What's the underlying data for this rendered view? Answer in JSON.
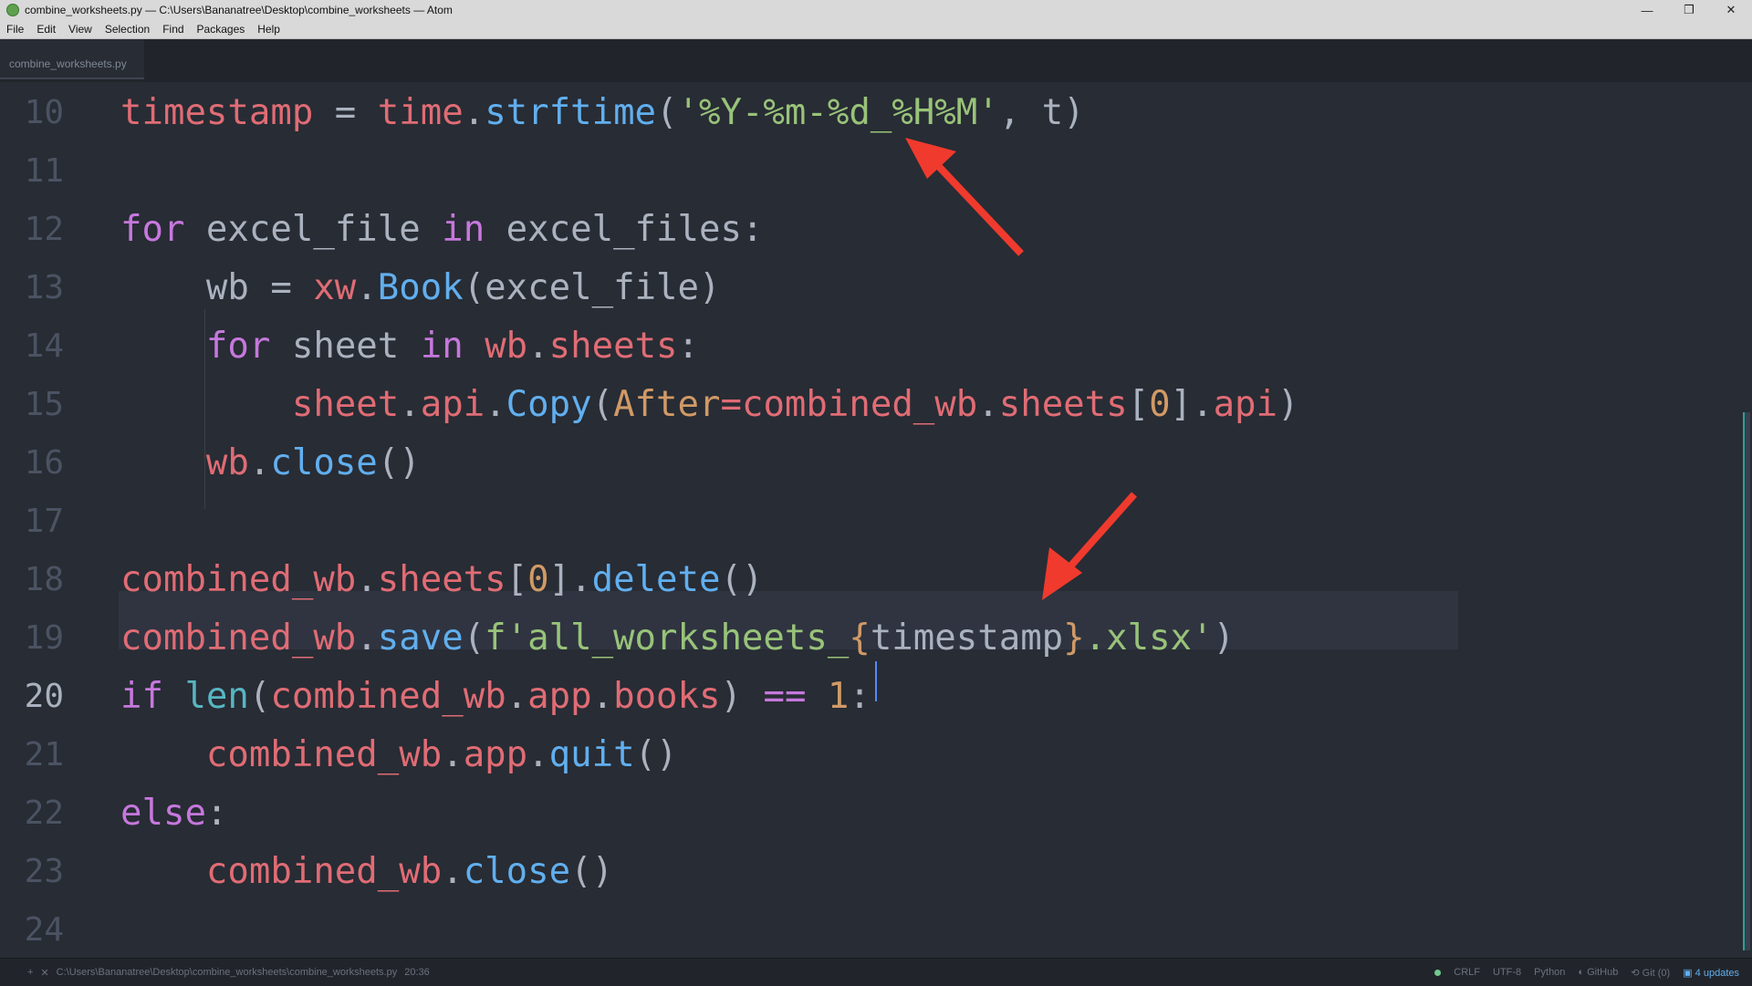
{
  "window": {
    "title": "combine_worksheets.py — C:\\Users\\Bananatree\\Desktop\\combine_worksheets — Atom",
    "minimize": "—",
    "maximize": "❐",
    "close": "✕"
  },
  "menu": [
    "File",
    "Edit",
    "View",
    "Selection",
    "Find",
    "Packages",
    "Help"
  ],
  "tab": {
    "label": "combine_worksheets.py"
  },
  "editor": {
    "active_line": "20",
    "lines": [
      {
        "num": "10",
        "tokens": [
          [
            "v",
            "timestamp"
          ],
          [
            "p",
            " = "
          ],
          [
            "v",
            "time"
          ],
          [
            "p",
            "."
          ],
          [
            "f",
            "strftime"
          ],
          [
            "p",
            "("
          ],
          [
            "s",
            "'%Y-%m-%d_%H%M'"
          ],
          [
            "p",
            ", t)"
          ]
        ]
      },
      {
        "num": "11",
        "tokens": []
      },
      {
        "num": "12",
        "tokens": [
          [
            "k",
            "for"
          ],
          [
            "p",
            " excel_file "
          ],
          [
            "k",
            "in"
          ],
          [
            "p",
            " excel_files:"
          ]
        ]
      },
      {
        "num": "13",
        "tokens": [
          [
            "p",
            "    wb = "
          ],
          [
            "v",
            "xw"
          ],
          [
            "p",
            "."
          ],
          [
            "f",
            "Book"
          ],
          [
            "p",
            "(excel_file)"
          ]
        ]
      },
      {
        "num": "14",
        "tokens": [
          [
            "k",
            "    for"
          ],
          [
            "p",
            " sheet "
          ],
          [
            "k",
            "in"
          ],
          [
            "p",
            " "
          ],
          [
            "v",
            "wb"
          ],
          [
            "p",
            "."
          ],
          [
            "v",
            "sheets"
          ],
          [
            "p",
            ":"
          ]
        ]
      },
      {
        "num": "15",
        "tokens": [
          [
            "p",
            "        "
          ],
          [
            "v",
            "sheet"
          ],
          [
            "p",
            "."
          ],
          [
            "v",
            "api"
          ],
          [
            "p",
            "."
          ],
          [
            "f",
            "Copy"
          ],
          [
            "p",
            "("
          ],
          [
            "n",
            "After"
          ],
          [
            "v",
            "="
          ],
          [
            "v",
            "combined_wb"
          ],
          [
            "p",
            "."
          ],
          [
            "v",
            "sheets"
          ],
          [
            "p",
            "["
          ],
          [
            "n",
            "0"
          ],
          [
            "p",
            "]."
          ],
          [
            "v",
            "api"
          ],
          [
            "p",
            ")"
          ]
        ]
      },
      {
        "num": "16",
        "tokens": [
          [
            "p",
            "    "
          ],
          [
            "v",
            "wb"
          ],
          [
            "p",
            "."
          ],
          [
            "f",
            "close"
          ],
          [
            "p",
            "()"
          ]
        ]
      },
      {
        "num": "17",
        "tokens": []
      },
      {
        "num": "18",
        "tokens": [
          [
            "v",
            "combined_wb"
          ],
          [
            "p",
            "."
          ],
          [
            "v",
            "sheets"
          ],
          [
            "p",
            "["
          ],
          [
            "n",
            "0"
          ],
          [
            "p",
            "]."
          ],
          [
            "f",
            "delete"
          ],
          [
            "p",
            "()"
          ]
        ]
      },
      {
        "num": "19",
        "tokens": [
          [
            "v",
            "combined_wb"
          ],
          [
            "p",
            "."
          ],
          [
            "f",
            "save"
          ],
          [
            "p",
            "("
          ],
          [
            "s",
            "f'all_worksheets_"
          ],
          [
            "n",
            "{"
          ],
          [
            "p",
            "timestamp"
          ],
          [
            "n",
            "}"
          ],
          [
            "s",
            ".xlsx'"
          ],
          [
            "p",
            ")"
          ]
        ]
      },
      {
        "num": "20",
        "tokens": [
          [
            "k",
            "if"
          ],
          [
            "p",
            " "
          ],
          [
            "o",
            "len"
          ],
          [
            "p",
            "("
          ],
          [
            "v",
            "combined_wb"
          ],
          [
            "p",
            "."
          ],
          [
            "v",
            "app"
          ],
          [
            "p",
            "."
          ],
          [
            "v",
            "books"
          ],
          [
            "p",
            ") "
          ],
          [
            "k",
            "=="
          ],
          [
            "p",
            " "
          ],
          [
            "n",
            "1"
          ],
          [
            "p",
            ":"
          ]
        ]
      },
      {
        "num": "21",
        "tokens": [
          [
            "p",
            "    "
          ],
          [
            "v",
            "combined_wb"
          ],
          [
            "p",
            "."
          ],
          [
            "v",
            "app"
          ],
          [
            "p",
            "."
          ],
          [
            "f",
            "quit"
          ],
          [
            "p",
            "()"
          ]
        ]
      },
      {
        "num": "22",
        "tokens": [
          [
            "k",
            "else"
          ],
          [
            "p",
            ":"
          ]
        ]
      },
      {
        "num": "23",
        "tokens": [
          [
            "p",
            "    "
          ],
          [
            "v",
            "combined_wb"
          ],
          [
            "p",
            "."
          ],
          [
            "f",
            "close"
          ],
          [
            "p",
            "()"
          ]
        ]
      },
      {
        "num": "24",
        "tokens": []
      }
    ]
  },
  "status": {
    "add": "+",
    "close": "✕",
    "path": "C:\\Users\\Bananatree\\Desktop\\combine_worksheets\\combine_worksheets.py",
    "cursor": "20:36",
    "line_ending": "CRLF",
    "encoding": "UTF-8",
    "grammar": "Python",
    "github": "GitHub",
    "git": "Git (0)",
    "updates": "4 updates"
  },
  "colors": {
    "arrow": "#f03a2e",
    "background": "#282c34"
  }
}
